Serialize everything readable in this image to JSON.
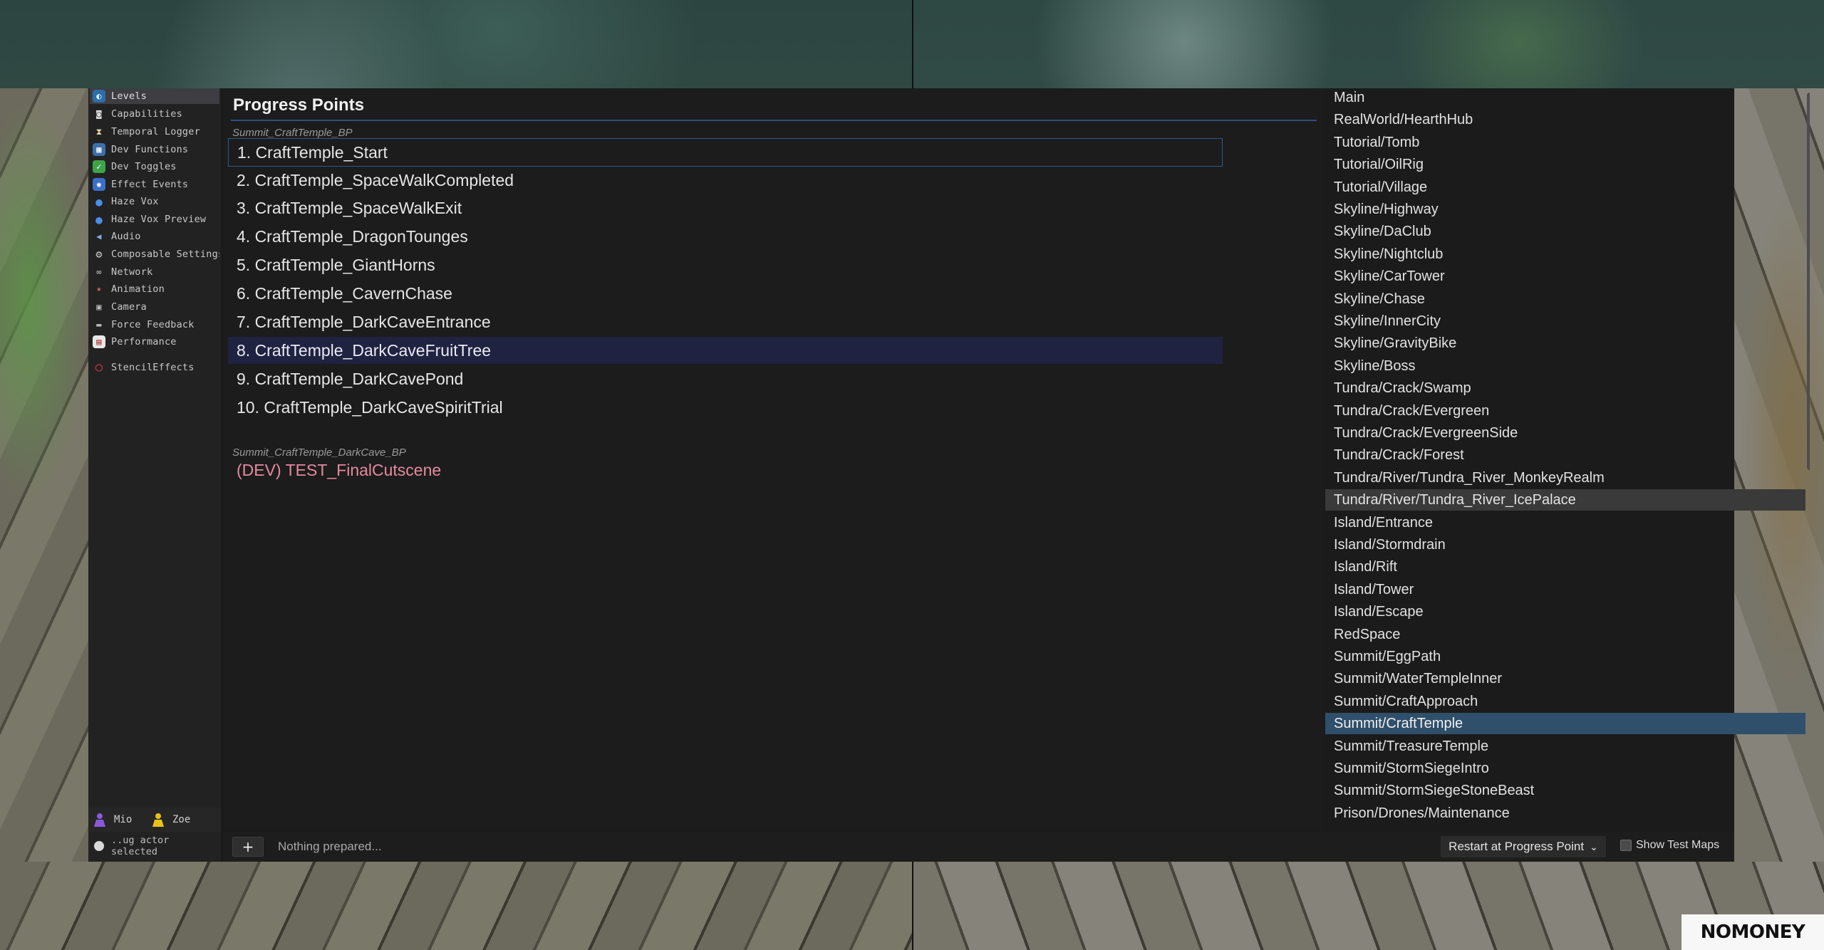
{
  "sidebar": {
    "items": [
      {
        "label": "Levels",
        "icon": "levels-icon",
        "active": true
      },
      {
        "label": "Capabilities",
        "icon": "goggles-icon"
      },
      {
        "label": "Temporal Logger",
        "icon": "hourglass-icon"
      },
      {
        "label": "Dev Functions",
        "icon": "grid-icon"
      },
      {
        "label": "Dev Toggles",
        "icon": "checkmark-icon"
      },
      {
        "label": "Effect Events",
        "icon": "sparkle-icon"
      },
      {
        "label": "Haze Vox",
        "icon": "speech-bubble-icon"
      },
      {
        "label": "Haze Vox Preview",
        "icon": "speech-bubble-icon"
      },
      {
        "label": "Audio",
        "icon": "speaker-icon"
      },
      {
        "label": "Composable Settings",
        "icon": "gear-icon"
      },
      {
        "label": "Network",
        "icon": "link-icon"
      },
      {
        "label": "Animation",
        "icon": "running-figure-icon"
      },
      {
        "label": "Camera",
        "icon": "camera-icon"
      },
      {
        "label": "Force Feedback",
        "icon": "gamepad-icon"
      },
      {
        "label": "Performance",
        "icon": "chart-icon"
      },
      {
        "label": "StencilEffects",
        "icon": "red-circle-icon"
      }
    ],
    "players": {
      "p1": "Mio",
      "p2": "Zoe"
    },
    "actor_status": "..ug actor selected"
  },
  "main": {
    "title": "Progress Points",
    "group1": "Summit_CraftTemple_BP",
    "points": [
      "1. CraftTemple_Start",
      "2. CraftTemple_SpaceWalkCompleted",
      "3. CraftTemple_SpaceWalkExit",
      "4. CraftTemple_DragonTounges",
      "5. CraftTemple_GiantHorns",
      "6. CraftTemple_CavernChase",
      "7. CraftTemple_DarkCaveEntrance",
      "8. CraftTemple_DarkCaveFruitTree",
      "9. CraftTemple_DarkCavePond",
      "10. CraftTemple_DarkCaveSpiritTrial"
    ],
    "group2": "Summit_CraftTemple_DarkCave_BP",
    "dev_point": "(DEV) TEST_FinalCutscene"
  },
  "bottom": {
    "add_label": "+",
    "status": "Nothing prepared...",
    "restart_label": "Restart at Progress Point",
    "show_test_maps": "Show Test Maps"
  },
  "levels": [
    "Main",
    "RealWorld/HearthHub",
    "Tutorial/Tomb",
    "Tutorial/OilRig",
    "Tutorial/Village",
    "Skyline/Highway",
    "Skyline/DaClub",
    "Skyline/Nightclub",
    "Skyline/CarTower",
    "Skyline/Chase",
    "Skyline/InnerCity",
    "Skyline/GravityBike",
    "Skyline/Boss",
    "Tundra/Crack/Swamp",
    "Tundra/Crack/Evergreen",
    "Tundra/Crack/EvergreenSide",
    "Tundra/Crack/Forest",
    "Tundra/River/Tundra_River_MonkeyRealm",
    "Tundra/River/Tundra_River_IcePalace",
    "Island/Entrance",
    "Island/Stormdrain",
    "Island/Rift",
    "Island/Tower",
    "Island/Escape",
    "RedSpace",
    "Summit/EggPath",
    "Summit/WaterTempleInner",
    "Summit/CraftApproach",
    "Summit/CraftTemple",
    "Summit/TreasureTemple",
    "Summit/StormSiegeIntro",
    "Summit/StormSiegeStoneBeast",
    "Prison/Drones/Maintenance"
  ],
  "watermark": "NOMONEY"
}
